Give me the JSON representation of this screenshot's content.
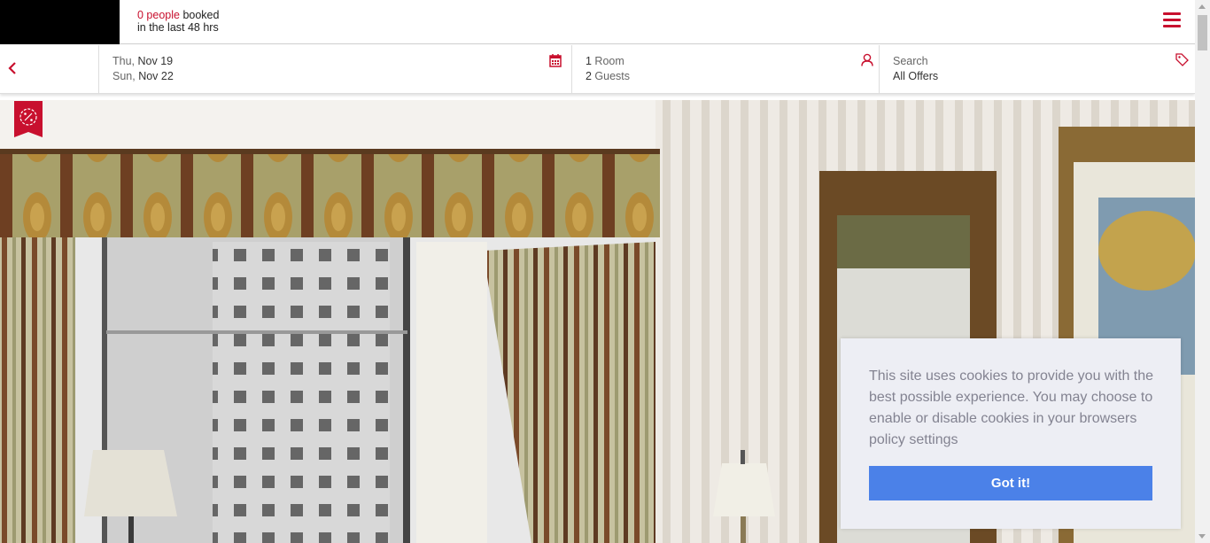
{
  "header": {
    "booked_count": "0 people",
    "booked_suffix": " booked",
    "booked_window": "in the last 48 hrs",
    "accent_color": "#c8102e",
    "menu_icon": "hamburger-menu-icon"
  },
  "search": {
    "back_icon": "chevron-left-icon",
    "checkin_day": "Thu, ",
    "checkin_date": "Nov 19",
    "checkout_day": "Sun, ",
    "checkout_date": "Nov 22",
    "calendar_icon": "calendar-icon",
    "rooms_count": "1",
    "rooms_label": " Room",
    "guests_count": "2",
    "guests_label": " Guests",
    "guest_icon": "user-icon",
    "offers_label": "Search",
    "offers_value": "All Offers",
    "offers_icon": "tag-icon"
  },
  "hero": {
    "badge_icon": "discount-percent-icon"
  },
  "cookie_banner": {
    "message": "This site uses cookies to provide you with the best possible experience. You may choose to enable or disable cookies in your browsers policy settings",
    "button_label": "Got it!",
    "button_color": "#4b81e8"
  }
}
